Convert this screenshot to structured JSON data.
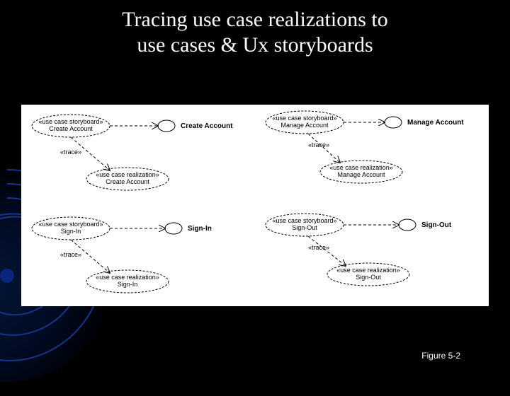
{
  "title_line1": "Tracing use case realizations to",
  "title_line2": "use cases & Ux storyboards",
  "caption": "Figure 5-2",
  "stereotypes": {
    "storyboard": "«use case storyboard»",
    "realization": "«use case realization»",
    "trace": "«trace»"
  },
  "groups": [
    {
      "storyboard_label": "Create Account",
      "usecase_label": "Create Account",
      "realization_label": "Create Account"
    },
    {
      "storyboard_label": "Manage Account",
      "usecase_label": "Manage Account",
      "realization_label": "Manage Account"
    },
    {
      "storyboard_label": "Sign-In",
      "usecase_label": "Sign-In",
      "realization_label": "Sign-In"
    },
    {
      "storyboard_label": "Sign-Out",
      "usecase_label": "Sign-Out",
      "realization_label": "Sign-Out"
    }
  ]
}
